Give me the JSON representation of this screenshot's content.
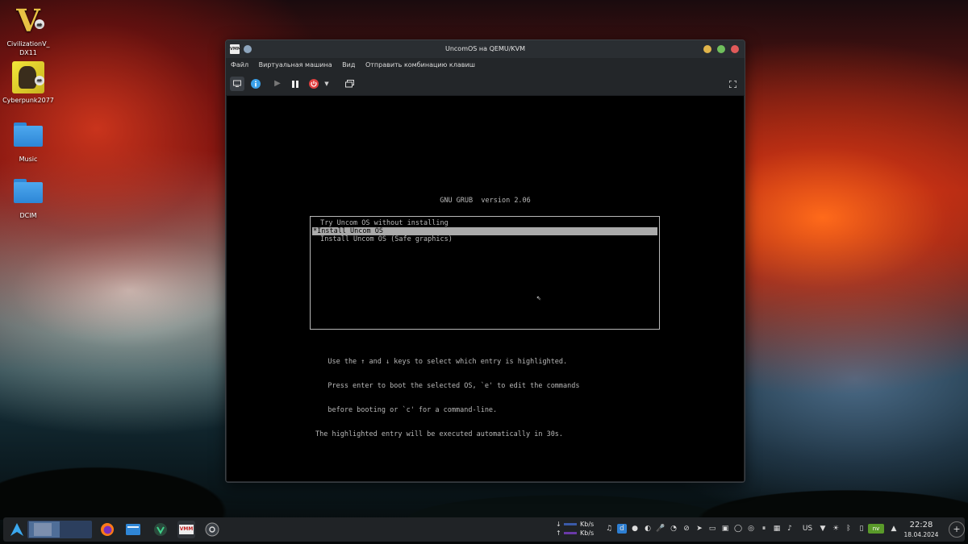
{
  "desktop": {
    "icons": [
      {
        "label": "CivilizationV_ DX11"
      },
      {
        "label": "Cyberpunk2077"
      },
      {
        "label": "Music"
      },
      {
        "label": "DCIM"
      }
    ]
  },
  "window": {
    "app_icon_text": "VMM",
    "title": "UncomOS на QEMU/KVM",
    "menu": [
      "Файл",
      "Виртуальная машина",
      "Вид",
      "Отправить комбинацию клавиш"
    ],
    "toolbar": [
      "console-icon",
      "info-icon",
      "play-icon",
      "pause-icon",
      "power-icon",
      "chevron-down-icon",
      "snapshots-icon",
      "fullscreen-icon"
    ],
    "colors": {
      "power": "#e04040",
      "info": "#3aa0e8",
      "min": "#e0b44a",
      "max": "#6fbf5c",
      "close": "#e05a5a"
    }
  },
  "grub": {
    "title": "GNU GRUB  version 2.06",
    "entries": [
      {
        "label": " Try Uncom OS without installing"
      },
      {
        "label": "*Install Uncom OS"
      },
      {
        "label": " Install Uncom OS (Safe graphics)"
      }
    ],
    "selected_index": 1,
    "help": [
      "   Use the ↑ and ↓ keys to select which entry is highlighted.",
      "   Press enter to boot the selected OS, `e' to edit the commands",
      "   before booting or `c' for a command-line.",
      "The highlighted entry will be executed automatically in 30s."
    ]
  },
  "taskbar": {
    "net": {
      "down_label": "Kb/s",
      "up_label": "Kb/s",
      "down_arrow": "↓",
      "up_arrow": "↑"
    },
    "tray_lang": "US",
    "time": "22:28",
    "date": "18.04.2024"
  }
}
